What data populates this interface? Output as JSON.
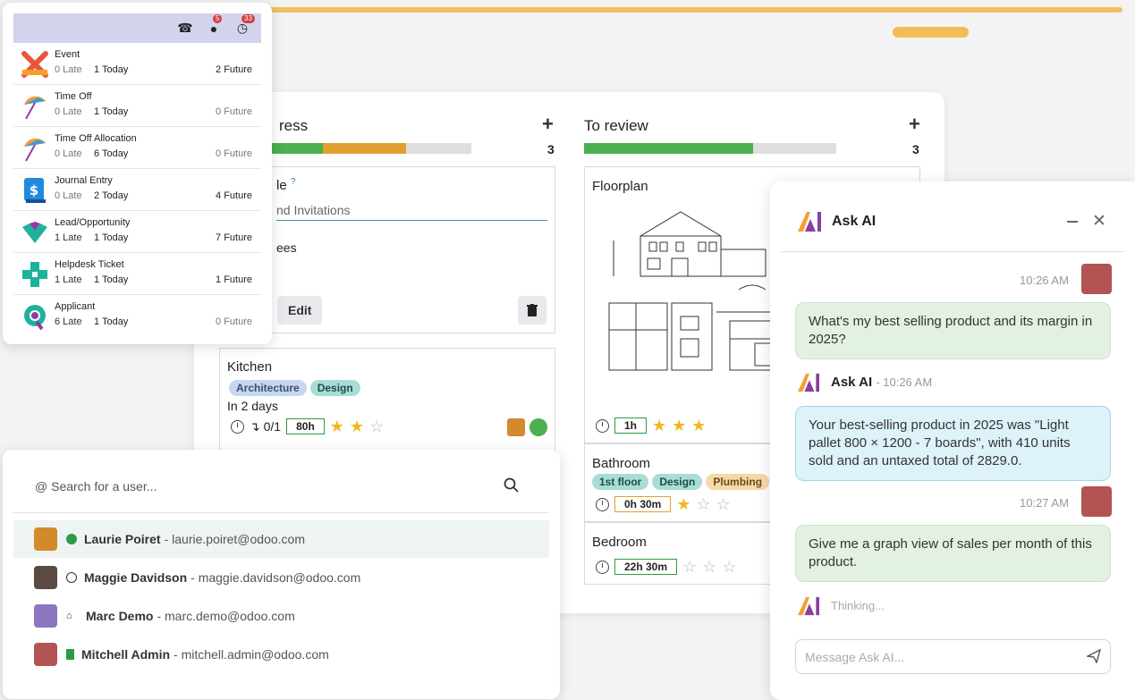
{
  "activity": {
    "icons": [
      {
        "name": "phone-icon",
        "badge": ""
      },
      {
        "name": "chat-icon",
        "badge": "5"
      },
      {
        "name": "clock-icon",
        "badge": "33"
      }
    ],
    "items": [
      {
        "name": "Event",
        "late": "0 Late",
        "today": "1 Today",
        "future": "2 Future"
      },
      {
        "name": "Time Off",
        "late": "0 Late",
        "today": "1 Today",
        "future": "0 Future"
      },
      {
        "name": "Time Off Allocation",
        "late": "0 Late",
        "today": "6 Today",
        "future": "0 Future"
      },
      {
        "name": "Journal Entry",
        "late": "0 Late",
        "today": "2 Today",
        "future": "4 Future"
      },
      {
        "name": "Lead/Opportunity",
        "late": "1 Late",
        "today": "1 Today",
        "future": "7 Future"
      },
      {
        "name": "Helpdesk Ticket",
        "late": "1 Late",
        "today": "1 Today",
        "future": "1 Future"
      },
      {
        "name": "Applicant",
        "late": "6 Late",
        "today": "1 Today",
        "future": "0 Future"
      }
    ]
  },
  "board": {
    "col1": {
      "title": "ress",
      "count": "3",
      "plus": "+",
      "progress": [
        0.28,
        0.42
      ],
      "edit_card": {
        "title_fragment": "le",
        "help": "?",
        "field_value": "nd Invitations",
        "assignees_fragment": "ees",
        "edit_label": "Edit"
      },
      "kitchen": {
        "title": "Kitchen",
        "tags": [
          "Architecture",
          "Design"
        ],
        "deadline": "In 2 days",
        "subtasks": "↴ 0/1",
        "hours": "80h",
        "stars": 2
      }
    },
    "col2": {
      "title": "To review",
      "count": "3",
      "plus": "+",
      "progress": [
        0.67
      ],
      "floorplan": {
        "title": "Floorplan",
        "hours": "1h",
        "stars": 3
      },
      "bathroom": {
        "title": "Bathroom",
        "tags": [
          "1st floor",
          "Design",
          "Plumbing"
        ],
        "hours": "0h 30m",
        "stars": 1
      },
      "bedroom": {
        "title": "Bedroom",
        "hours": "22h 30m",
        "stars": 0
      }
    }
  },
  "users": {
    "search_placeholder": "@ Search for a user...",
    "rows": [
      {
        "name": "Laurie Poiret",
        "email": "- laurie.poiret@odoo.com",
        "status": "online"
      },
      {
        "name": "Maggie Davidson",
        "email": "- maggie.davidson@odoo.com",
        "status": "offline"
      },
      {
        "name": "Marc Demo",
        "email": "- marc.demo@odoo.com",
        "status": "home"
      },
      {
        "name": "Mitchell Admin",
        "email": "- mitchell.admin@odoo.com",
        "status": "office"
      }
    ]
  },
  "askai": {
    "title": "Ask AI",
    "messages": [
      {
        "time": "10:26 AM",
        "text": "What's my best selling product and its margin in 2025?"
      },
      {
        "name": "Ask AI",
        "time": "- 10:26 AM",
        "text": "Your best-selling product in 2025 was \"Light pallet 800 × 1200 - 7 boards\", with 410 units sold and an untaxed total of 2829.0."
      },
      {
        "time": "10:27 AM",
        "text": "Give me a graph view of sales per month of this product."
      }
    ],
    "thinking": "Thinking...",
    "input_placeholder": "Message Ask AI..."
  },
  "colors": {
    "green": "#2a9d44",
    "amber": "#e0a030",
    "ai_purple": "#7b3fa0"
  }
}
